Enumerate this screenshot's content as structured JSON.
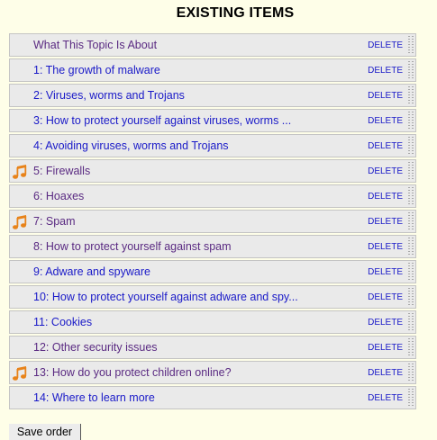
{
  "heading": "EXISTING ITEMS",
  "delete_label": "DELETE",
  "colors": {
    "background": "#fefee8",
    "row_background": "#eaeaea",
    "link": "#1a1ac8",
    "visited": "#5a2a82",
    "music_icon": "#e8831a"
  },
  "items": [
    {
      "title": "What This Topic Is About",
      "visited": true,
      "icon": null
    },
    {
      "title": "1: The growth of malware",
      "visited": false,
      "icon": null
    },
    {
      "title": "2: Viruses, worms and Trojans",
      "visited": false,
      "icon": null
    },
    {
      "title": "3: How to protect yourself against viruses, worms ...",
      "visited": false,
      "icon": null
    },
    {
      "title": "4: Avoiding viruses, worms and Trojans",
      "visited": false,
      "icon": null
    },
    {
      "title": "5: Firewalls",
      "visited": true,
      "icon": "music-note-icon"
    },
    {
      "title": "6: Hoaxes",
      "visited": true,
      "icon": null
    },
    {
      "title": "7: Spam",
      "visited": true,
      "icon": "music-note-icon"
    },
    {
      "title": "8: How to protect yourself against spam",
      "visited": true,
      "icon": null
    },
    {
      "title": "9: Adware and spyware",
      "visited": false,
      "icon": null
    },
    {
      "title": "10: How to protect yourself against adware and spy...",
      "visited": false,
      "icon": null
    },
    {
      "title": "11: Cookies",
      "visited": false,
      "icon": null
    },
    {
      "title": "12: Other security issues",
      "visited": true,
      "icon": null
    },
    {
      "title": "13: How do you protect children online?",
      "visited": true,
      "icon": "music-note-icon"
    },
    {
      "title": "14: Where to learn more",
      "visited": false,
      "icon": null
    }
  ],
  "save_button_label": "Save order"
}
